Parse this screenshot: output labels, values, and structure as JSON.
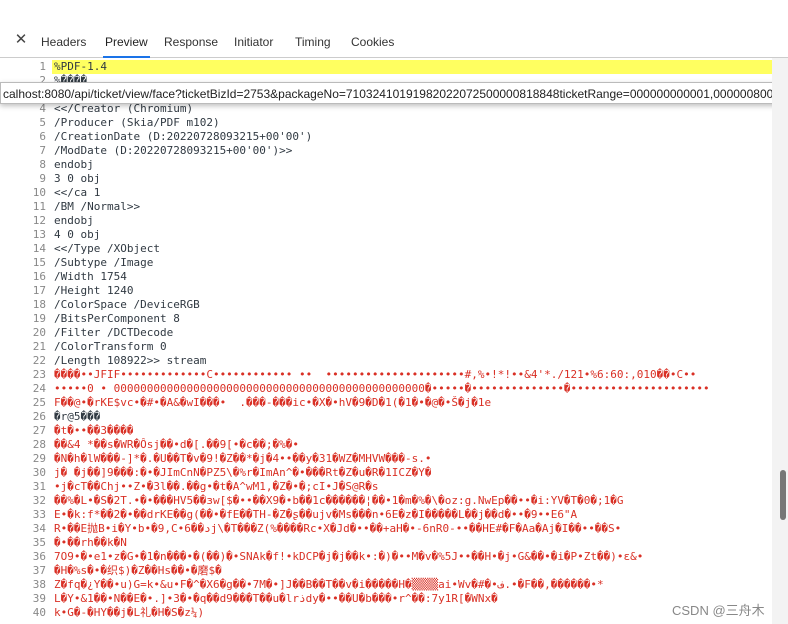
{
  "devtools": {
    "tabs": [
      {
        "label": "Headers",
        "active": false
      },
      {
        "label": "Preview",
        "active": true
      },
      {
        "label": "Response",
        "active": false
      },
      {
        "label": "Initiator",
        "active": false
      },
      {
        "label": "Timing",
        "active": false
      },
      {
        "label": "Cookies",
        "active": false
      }
    ]
  },
  "tooltip": {
    "url": "calhost:8080/api/ticket/view/face?ticketBizId=2753&packageNo=71032410191982022072500000818848ticketRange=000000000001,000000800000"
  },
  "editor": {
    "lines": [
      {
        "n": "1",
        "text": "%PDF-1.4"
      },
      {
        "n": "2",
        "text": "%����"
      },
      {
        "n": "3",
        "text": ""
      },
      {
        "n": "4",
        "text": "<</Creator (Chromium)"
      },
      {
        "n": "5",
        "text": "/Producer (Skia/PDF m102)"
      },
      {
        "n": "6",
        "text": "/CreationDate (D:20220728093215+00'00')"
      },
      {
        "n": "7",
        "text": "/ModDate (D:20220728093215+00'00')>>"
      },
      {
        "n": "8",
        "text": "endobj"
      },
      {
        "n": "9",
        "text": "3 0 obj"
      },
      {
        "n": "10",
        "text": "<</ca 1"
      },
      {
        "n": "11",
        "text": "/BM /Normal>>"
      },
      {
        "n": "12",
        "text": "endobj"
      },
      {
        "n": "13",
        "text": "4 0 obj"
      },
      {
        "n": "14",
        "text": "<</Type /XObject"
      },
      {
        "n": "15",
        "text": "/Subtype /Image"
      },
      {
        "n": "16",
        "text": "/Width 1754"
      },
      {
        "n": "17",
        "text": "/Height 1240"
      },
      {
        "n": "18",
        "text": "/ColorSpace /DeviceRGB"
      },
      {
        "n": "19",
        "text": "/BitsPerComponent 8"
      },
      {
        "n": "20",
        "text": "/Filter /DCTDecode"
      },
      {
        "n": "21",
        "text": "/ColorTransform 0"
      },
      {
        "n": "22",
        "text": "/Length 108922>> stream"
      },
      {
        "n": "23",
        "text": "����••JFIF•••••••••••••C•••••••••••• ••  •••••••••••••••••••••#,%•!*!••&4'*./121•%6:60:,010��•C••"
      },
      {
        "n": "24",
        "text": "•••••0 • 00000000000000000000000000000000000000000000000�•••••�••••••••••••••�•••••••••••••••••••••"
      },
      {
        "n": "25",
        "text": "F��@•�rKE$vc•�#•�A&�wI���•  .���-���ic•�X�•hV�9�D�1(�1�•�@�•Š�j�1e"
      },
      {
        "n": "26",
        "text": "�r@5���"
      },
      {
        "n": "27",
        "text": "�t�••��3����"
      },
      {
        "n": "28",
        "text": "��&4 *��s�WR�Ôsj��•d�[.��9[•�c��;�%�•"
      },
      {
        "n": "29",
        "text": "�N�h�lW���-]*�.�U��T�v�9!�Z��*�j�4••��y�31�WZ�MHVW���-s.•"
      },
      {
        "n": "30",
        "text": "j� �j��]9���:�•�JImCnN�PZ5\\�%r�ImAn^�•���Rt�Z�u�R�1ICZ�Y�"
      },
      {
        "n": "31",
        "text": "•j�cT��Chj••Z•�3l��.��g•�t�A^wM1,�Z�•�;cI•J�S@R�s"
      },
      {
        "n": "32",
        "text": "��%�L•�S�2T.•�•���HV5��ɜw[$�••��X9�•b��1c������¦��•1�m�%�\\�oz:g.NwEp��••�i:YV�T�0�;1�G"
      },
      {
        "n": "33",
        "text": "E•�k:f*��2�•��drKE��g(��•�fE��TH-�Z�ʂ��ujv�Ms���n•6E�z�I�����L��j��d�••�9••E6\"A"
      },
      {
        "n": "34",
        "text": "R•��E抛B•i�Y•b•�9,C•6��دj\\�T���Z(%����Rc•X�Jd�••��+aH�•-6nR0-••��HE#�F�Aa�Aj�I��••��S•"
      },
      {
        "n": "35",
        "text": "�•��rh��k�N"
      },
      {
        "n": "36",
        "text": "7O9•�•e1•z�G•�1�n���•�(��)�•SNAk�f!•kDCP�j�j��k•:�)�••M�v�%5J••��H•�j•G&��•�i�P•Zt��)•ε&•"
      },
      {
        "n": "37",
        "text": "�H�%s�•�织$)�Z��Hs��•�磨$�"
      },
      {
        "n": "38",
        "text": "Z�fq�¿Y��•u)G=k•&u•F�^�X6�g��•7M�•]J��B��T��v�i�����H�▒▒▒▒ai•Wv�#�•ف.•�F��,������•*"
      },
      {
        "n": "39",
        "text": "L�Y•&1��•N��E�•.]•3�•�q��d9���T��u�lrذdy�••��U�b���•r^��:7y1R[�WNx�"
      },
      {
        "n": "40",
        "text": "k•G�-�HY��j�L礼�H�S�z¼)"
      }
    ]
  },
  "watermark": "CSDN @三舟木",
  "colors": {
    "highlight": "#ffff60",
    "accent": "#1a73e8",
    "error": "#d93025"
  }
}
